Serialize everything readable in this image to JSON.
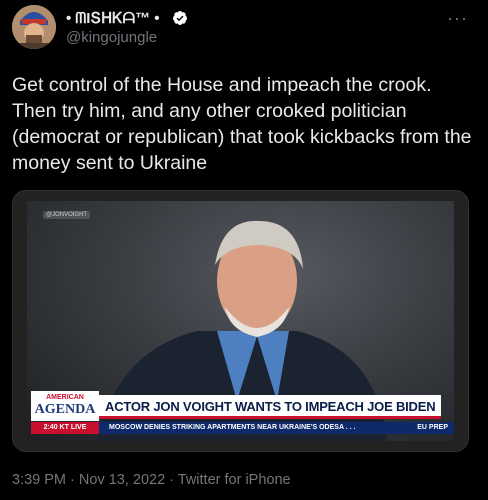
{
  "tweet": {
    "display_name": "• ᗰIՏᕼᏦᗩ™ •",
    "handle": "@kingojungle",
    "more": "···",
    "text": "Get control of the House and impeach the crook. Then try him, and any other crooked politician (democrat or republican) that took kickbacks from the money sent to Ukraine",
    "timestamp": "3:39 PM · Nov 13, 2022 · Twitter for iPhone"
  },
  "video": {
    "watermark": "@JONVOIGHT",
    "brand_top": "AMERICAN",
    "brand_main": "AGENDA",
    "headline": "ACTOR JON VOIGHT WANTS TO IMPEACH JOE BIDEN",
    "time": "2:40 KT   LIVE",
    "ticker": "MOSCOW DENIES STRIKING APARTMENTS NEAR UKRAINE'S ODESA . . .",
    "ticker_right": "EU PREP"
  },
  "colors": {
    "background": "#000000",
    "text": "#e7e9ea",
    "secondary": "#71767b",
    "verified": "#ffffff",
    "accent_red": "#c8102e",
    "accent_navy": "#0e2a6b"
  },
  "icons": {
    "verified": "verified-badge-icon",
    "more": "more-horizontal-icon"
  }
}
